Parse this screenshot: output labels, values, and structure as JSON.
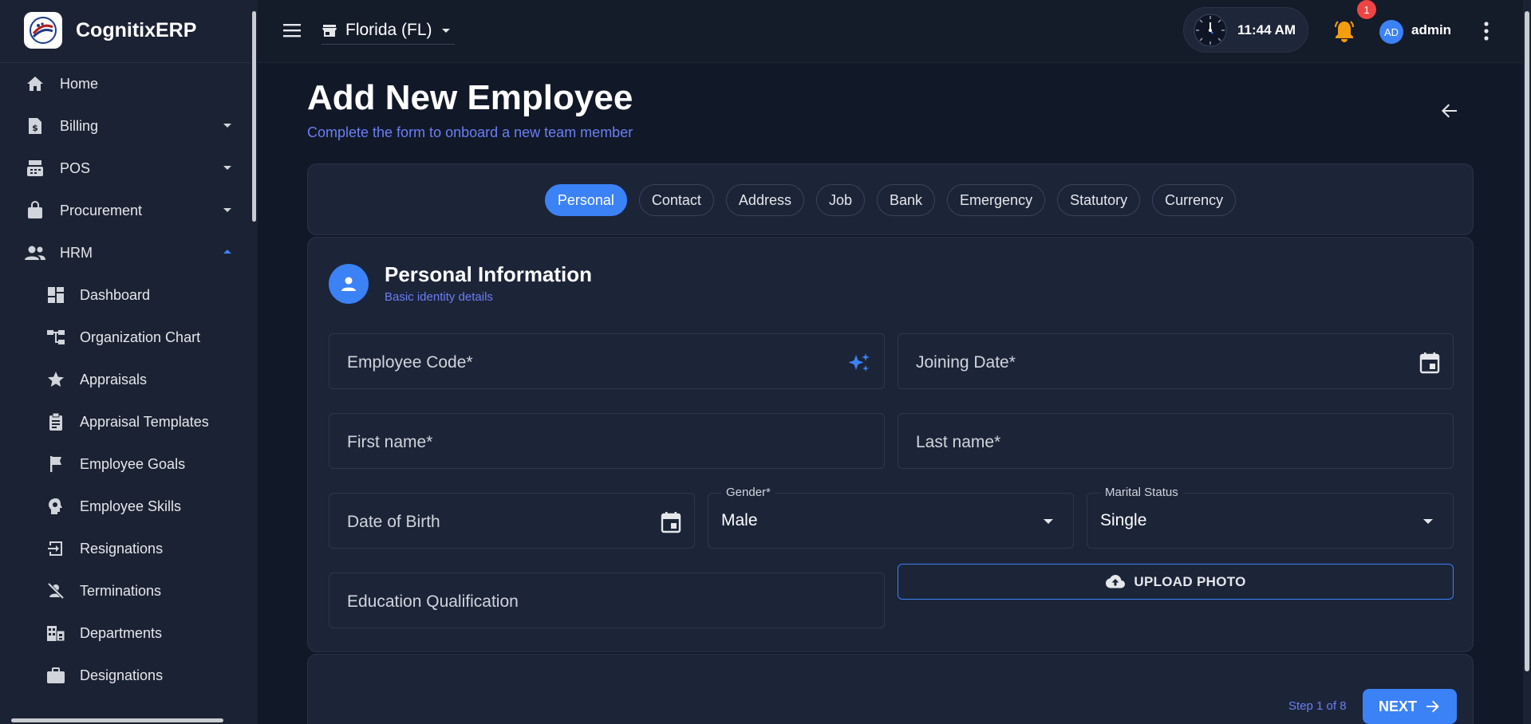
{
  "app": {
    "name": "CognitixERP"
  },
  "sidebar": {
    "items": [
      {
        "label": "Home",
        "icon": "home-icon"
      },
      {
        "label": "Billing",
        "icon": "billing-icon"
      },
      {
        "label": "POS",
        "icon": "pos-icon"
      },
      {
        "label": "Procurement",
        "icon": "bag-icon"
      },
      {
        "label": "HRM",
        "icon": "people-icon"
      }
    ],
    "sub_items": [
      {
        "label": "Dashboard",
        "icon": "dashboard-icon"
      },
      {
        "label": "Organization Chart",
        "icon": "org-chart-icon"
      },
      {
        "label": "Appraisals",
        "icon": "star-icon"
      },
      {
        "label": "Appraisal Templates",
        "icon": "clipboard-icon"
      },
      {
        "label": "Employee Goals",
        "icon": "flag-icon"
      },
      {
        "label": "Employee Skills",
        "icon": "skills-icon"
      },
      {
        "label": "Resignations",
        "icon": "exit-icon"
      },
      {
        "label": "Terminations",
        "icon": "person-off-icon"
      },
      {
        "label": "Departments",
        "icon": "building-icon"
      },
      {
        "label": "Designations",
        "icon": "briefcase-icon"
      }
    ]
  },
  "topbar": {
    "store": "Florida (FL)",
    "time": "11:44 AM",
    "notification_count": "1",
    "avatar_initials": "AD",
    "user": "admin"
  },
  "header": {
    "title": "Add New Employee",
    "subtitle": "Complete the form to onboard a new team member"
  },
  "tabs": [
    {
      "label": "Personal"
    },
    {
      "label": "Contact"
    },
    {
      "label": "Address"
    },
    {
      "label": "Job"
    },
    {
      "label": "Bank"
    },
    {
      "label": "Emergency"
    },
    {
      "label": "Statutory"
    },
    {
      "label": "Currency"
    }
  ],
  "active_tab": "Personal",
  "section": {
    "title": "Personal Information",
    "subtitle": "Basic identity details"
  },
  "form": {
    "employee_code": "Employee Code*",
    "joining_date": "Joining Date*",
    "first_name": "First name*",
    "last_name": "Last name*",
    "dob": "Date of Birth",
    "gender_label": "Gender*",
    "gender_value": "Male",
    "marital_label": "Marital Status",
    "marital_value": "Single",
    "education": "Education Qualification",
    "upload_label": "UPLOAD PHOTO"
  },
  "footer": {
    "step": "Step 1 of 8",
    "next": "NEXT"
  },
  "colors": {
    "accent": "#3b82f6",
    "subtitle": "#6b7ff5",
    "badge": "#ef4444",
    "bell": "#f59e0b"
  }
}
